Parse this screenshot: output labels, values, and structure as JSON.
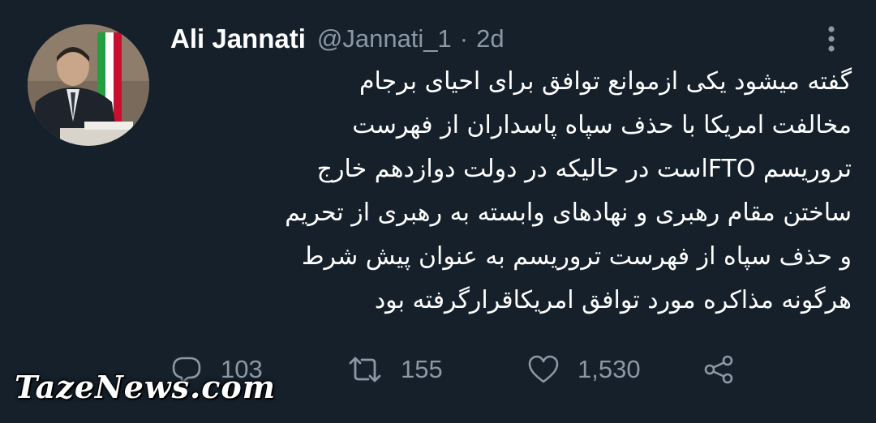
{
  "author": {
    "name": "Ali Jannati",
    "handle": "@Jannati_1",
    "separator": "·",
    "time": "2d"
  },
  "tweet": {
    "lines": [
      "گفته میشود یکی ازموانع توافق برای احیای برجام",
      "مخالفت امریکا با حذف سپاه پاسداران از فهرست",
      "تروریسم FTOاست در حالیکه در دولت دوازدهم خارج",
      "ساختن مقام رهبری و نهادهای وابسته به رهبری از تحریم",
      "و حذف سپاه از فهرست تروریسم به عنوان پیش شرط",
      "هرگونه مذاکره مورد توافق امریکاقرارگرفته بود"
    ]
  },
  "actions": {
    "replies": "103",
    "retweets": "155",
    "likes": "1,530"
  },
  "icons": {
    "more": "more-vertical-icon",
    "reply": "reply-icon",
    "retweet": "retweet-icon",
    "like": "heart-icon",
    "share": "share-icon"
  },
  "watermark": "TazeNews.com",
  "colors": {
    "background": "#15202b",
    "text": "#ffffff",
    "secondary": "#8b98a5",
    "flag_red": "#c8102e",
    "flag_green": "#239f40"
  }
}
